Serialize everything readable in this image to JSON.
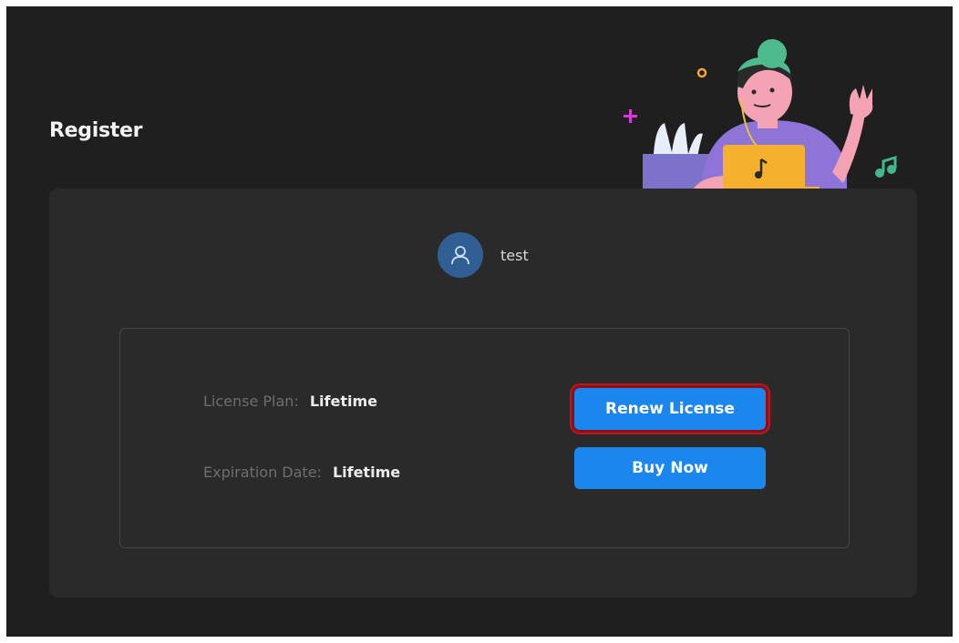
{
  "page": {
    "title": "Register"
  },
  "user": {
    "name": "test",
    "avatar_icon": "user-icon"
  },
  "license": {
    "plan_label": "License Plan:",
    "plan_value": "Lifetime",
    "expiration_label": "Expiration Date:",
    "expiration_value": "Lifetime"
  },
  "actions": {
    "renew_label": "Renew License",
    "buy_label": "Buy Now"
  },
  "colors": {
    "background": "#1f1f1f",
    "card": "#2a2a2a",
    "accent": "#1a86ee",
    "highlight": "#b81820"
  }
}
